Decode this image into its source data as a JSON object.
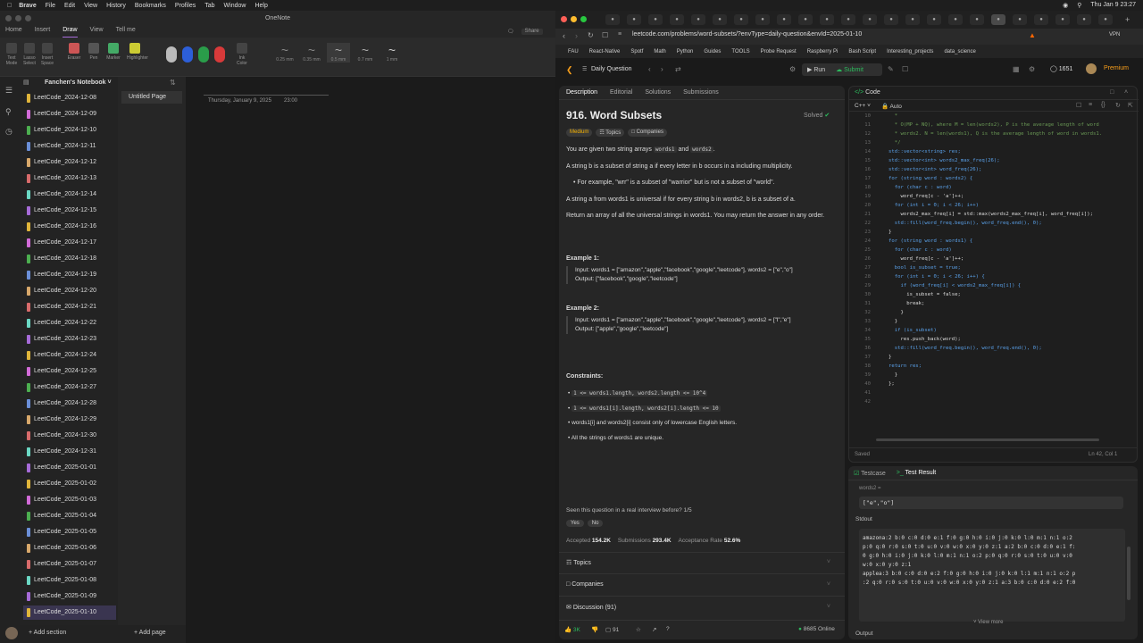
{
  "menubar": {
    "app": "Brave",
    "items": [
      "File",
      "Edit",
      "View",
      "History",
      "Bookmarks",
      "Profiles",
      "Tab",
      "Window",
      "Help"
    ],
    "clock": "Thu Jan 9  23:27"
  },
  "onenote": {
    "title": "OneNote",
    "tabs": [
      "Home",
      "Insert",
      "Draw",
      "View",
      "Tell me"
    ],
    "ribbon_tools": [
      "Text Mode",
      "Lasso Select",
      "Insert Space",
      "Eraser",
      "Pen",
      "Marker",
      "Highlighter",
      "Ink Color"
    ],
    "pen_sizes": [
      "0.25 mm",
      "0.35 mm",
      "0.5 mm",
      "0.7 mm",
      "1 mm"
    ],
    "share": "Share",
    "notebook": "Fanchen's Notebook",
    "sections": [
      "LeetCode_2024-12-08",
      "LeetCode_2024-12-09",
      "LeetCode_2024-12-10",
      "LeetCode_2024-12-11",
      "LeetCode_2024-12-12",
      "LeetCode_2024-12-13",
      "LeetCode_2024-12-14",
      "LeetCode_2024-12-15",
      "LeetCode_2024-12-16",
      "LeetCode_2024-12-17",
      "LeetCode_2024-12-18",
      "LeetCode_2024-12-19",
      "LeetCode_2024-12-20",
      "LeetCode_2024-12-21",
      "LeetCode_2024-12-22",
      "LeetCode_2024-12-23",
      "LeetCode_2024-12-24",
      "LeetCode_2024-12-25",
      "LeetCode_2024-12-27",
      "LeetCode_2024-12-28",
      "LeetCode_2024-12-29",
      "LeetCode_2024-12-30",
      "LeetCode_2024-12-31",
      "LeetCode_2025-01-01",
      "LeetCode_2025-01-02",
      "LeetCode_2025-01-03",
      "LeetCode_2025-01-04",
      "LeetCode_2025-01-05",
      "LeetCode_2025-01-06",
      "LeetCode_2025-01-07",
      "LeetCode_2025-01-08",
      "LeetCode_2025-01-09",
      "LeetCode_2025-01-10"
    ],
    "section_colors": [
      "#e0b53a",
      "#d26bd8",
      "#4caf50",
      "#6b8fd8",
      "#d8a86b",
      "#d86b6b",
      "#6bd8c4",
      "#a66bd8"
    ],
    "page": "Untitled Page",
    "date": "Thursday, January 9, 2025",
    "time": "23:00",
    "add_section": "Add section",
    "add_page": "Add page"
  },
  "browser": {
    "url": "leetcode.com/problems/word-subsets/?envType=daily-question&envId=2025-01-10",
    "vpn": "VPN",
    "bookmarks": [
      "FAU",
      "React-Native",
      "Spotf",
      "Math",
      "Python",
      "Guides",
      "TOOLS",
      "Probe Request",
      "Raspberry Pi",
      "Bash Script",
      "Interesting_projects",
      "data_science"
    ]
  },
  "leetcode": {
    "daily": "Daily Question",
    "run": "Run",
    "submit": "Submit",
    "coins": "1651",
    "premium": "Premium",
    "tabs": [
      "Description",
      "Editorial",
      "Solutions",
      "Submissions"
    ],
    "title": "916. Word Subsets",
    "solved": "Solved",
    "difficulty": "Medium",
    "topics": "Topics",
    "companies": "Companies",
    "p1a": "You are given two string arrays",
    "p1b": "words1",
    "p1c": "and",
    "p1d": "words2",
    "p2": "A string b is a subset of string a if every letter in b occurs in a including multiplicity.",
    "bullet": "For example, \"wrr\" is a subset of \"warrior\" but is not a subset of \"world\".",
    "p3": "A string a from words1 is universal if for every string b in words2, b is a subset of a.",
    "p4": "Return an array of all the universal strings in words1. You may return the answer in any order.",
    "ex1_title": "Example 1:",
    "ex1_input": "Input: words1 = [\"amazon\",\"apple\",\"facebook\",\"google\",\"leetcode\"], words2 = [\"e\",\"o\"]",
    "ex1_output": "Output: [\"facebook\",\"google\",\"leetcode\"]",
    "ex2_title": "Example 2:",
    "ex2_input": "Input: words1 = [\"amazon\",\"apple\",\"facebook\",\"google\",\"leetcode\"], words2 = [\"l\",\"e\"]",
    "ex2_output": "Output: [\"apple\",\"google\",\"leetcode\"]",
    "constraints_title": "Constraints:",
    "constraints": [
      "1 <= words1.length, words2.length <= 10^4",
      "1 <= words1[i].length, words2[i].length <= 10",
      "words1[i] and words2[i] consist only of lowercase English letters.",
      "All the strings of words1 are unique."
    ],
    "interview_q": "Seen this question in a real interview before?  1/5",
    "yes": "Yes",
    "no": "No",
    "accepted_label": "Accepted",
    "accepted": "154.2K",
    "submissions_label": "Submissions",
    "submissions": "293.4K",
    "rate_label": "Acceptance Rate",
    "rate": "52.6%",
    "acc_topics": "Topics",
    "acc_companies": "Companies",
    "discussion": "Discussion (91)",
    "likes": "3K",
    "comments": "91",
    "online": "8685 Online",
    "code_tab": "Code",
    "lang": "C++",
    "auto": "Auto",
    "saved": "Saved",
    "pos": "Ln 42, Col 1",
    "code": [
      {
        "n": "10",
        "t": "  *"
      },
      {
        "n": "11",
        "t": "  * O(MP + NQ), where M = len(words2), P is the average length of word"
      },
      {
        "n": "12",
        "t": "  * words2. N = len(words1), Q is the average length of word in words1."
      },
      {
        "n": "13",
        "t": "  */"
      },
      {
        "n": "14",
        "t": "std::vector<string> res;"
      },
      {
        "n": "15",
        "t": "std::vector<int> words2_max_freq(26);"
      },
      {
        "n": "16",
        "t": "std::vector<int> word_freq(26);"
      },
      {
        "n": "17",
        "t": "for (string word : words2) {"
      },
      {
        "n": "18",
        "t": "  for (char c : word)"
      },
      {
        "n": "19",
        "t": "    word_freq[c - 'a']++;"
      },
      {
        "n": "20",
        "t": "  for (int i = 0; i < 26; i++)"
      },
      {
        "n": "21",
        "t": "    words2_max_freq[i] = std::max(words2_max_freq[i], word_freq[i]);"
      },
      {
        "n": "22",
        "t": "  std::fill(word_freq.begin(), word_freq.end(), 0);"
      },
      {
        "n": "23",
        "t": "}"
      },
      {
        "n": "24",
        "t": "for (string word : words1) {"
      },
      {
        "n": "25",
        "t": "  for (char c : word)"
      },
      {
        "n": "26",
        "t": "    word_freq[c - 'a']++;"
      },
      {
        "n": "27",
        "t": "  bool is_subset = true;"
      },
      {
        "n": "28",
        "t": "  for (int i = 0; i < 26; i++) {"
      },
      {
        "n": "29",
        "t": "    if (word_freq[i] < words2_max_freq[i]) {"
      },
      {
        "n": "30",
        "t": "      is_subset = false;"
      },
      {
        "n": "31",
        "t": "      break;"
      },
      {
        "n": "32",
        "t": "    }"
      },
      {
        "n": "33",
        "t": "  }"
      },
      {
        "n": "34",
        "t": "  if (is_subset)"
      },
      {
        "n": "35",
        "t": "    res.push_back(word);"
      },
      {
        "n": "36",
        "t": "  std::fill(word_freq.begin(), word_freq.end(), 0);"
      },
      {
        "n": "37",
        "t": "}"
      },
      {
        "n": "38",
        "t": "return res;"
      },
      {
        "n": "39",
        "t": "  }"
      },
      {
        "n": "40",
        "t": "};"
      },
      {
        "n": "41",
        "t": ""
      },
      {
        "n": "42",
        "t": ""
      }
    ],
    "testcase_tab": "Testcase",
    "result_tab": "Test Result",
    "words2_label": "words2 =",
    "words2_val": "[\"e\",\"o\"]",
    "stdout_label": "Stdout",
    "stdout": [
      "amazona:2 b:0 c:0 d:0 e:1 f:0 g:0 h:0 i:0 j:0 k:0 l:0 m:1 n:1 o:2",
      "p:0 q:0 r:0 s:0 t:0 u:0 v:0 w:0 x:0 y:0 z:1 a:2 b:0 c:0 d:0 e:1 f:",
      "0 g:0 h:0 i:0 j:0 k:0 l:0 m:1 n:1 o:2 p:0 q:0 r:0 s:0 t:0 u:0 v:0",
      "w:0 x:0 y:0 z:1",
      "applea:3 b:0 c:0 d:0 e:2 f:0 g:0 h:0 i:0 j:0 k:0 l:1 m:1 n:1 o:2 p",
      ":2 q:0 r:0 s:0 t:0 u:0 v:0 w:0 x:0 y:0 z:1 a:3 b:0 c:0 d:0 e:2 f:0"
    ],
    "view_more": "View more",
    "output_label": "Output"
  }
}
